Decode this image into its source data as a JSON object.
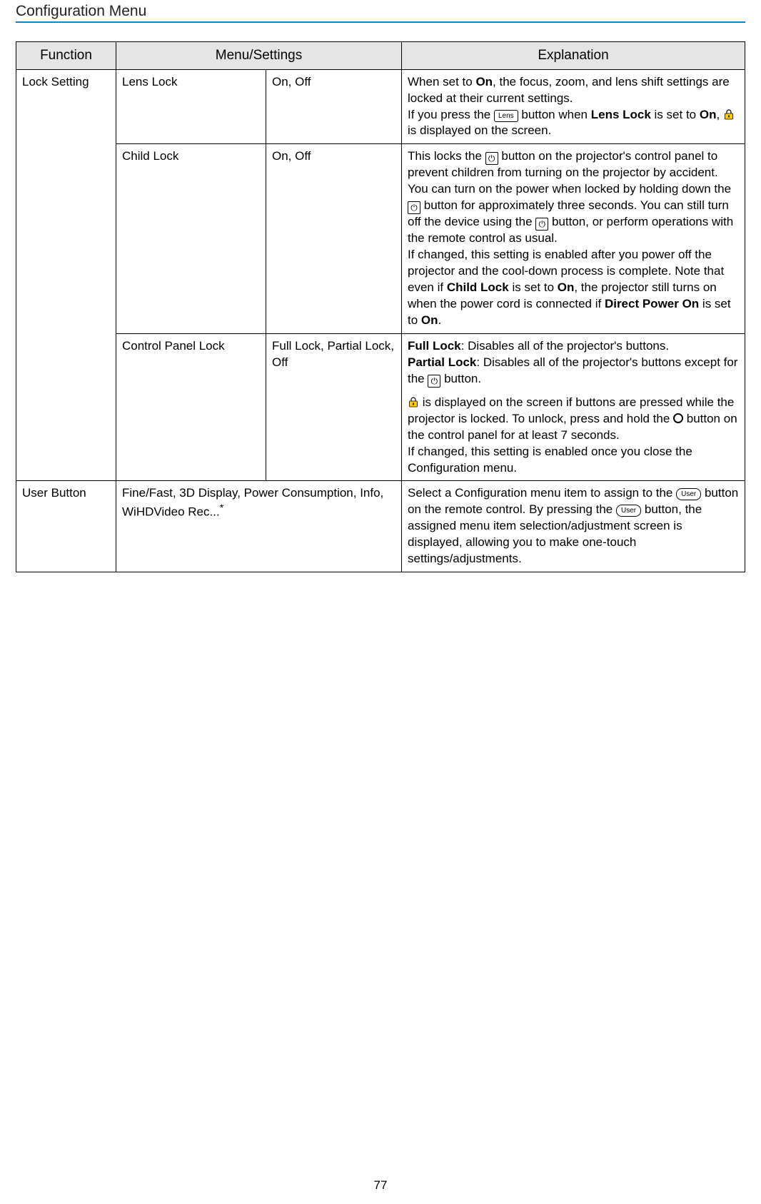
{
  "page": {
    "header": "Configuration Menu",
    "number": "77"
  },
  "table": {
    "headers": {
      "function": "Function",
      "menu": "Menu/Settings",
      "explanation": "Explanation"
    },
    "rows": {
      "lock_setting": {
        "function": "Lock Setting",
        "lens_lock": {
          "menu": "Lens Lock",
          "settings": "On, Off",
          "exp_pre": "When set to ",
          "exp_on1": "On",
          "exp_mid1": ", the focus, zoom, and lens shift settings are locked at their current settings.",
          "exp_line2a": "If you press the ",
          "lens_btn": "Lens",
          "exp_line2b": " button when ",
          "exp_lenslock_b": "Lens Lock",
          "exp_line2c": " is set to ",
          "exp_on2": "On",
          "exp_line2d": ", ",
          "exp_line2e": " is displayed on the screen."
        },
        "child_lock": {
          "menu": "Child Lock",
          "settings": "On, Off",
          "t1": "This locks the ",
          "t2": " button on the projector's control panel to prevent children from turning on the projector by accident. You can turn on the power when locked by holding down the ",
          "t3": " button for approximately three seconds. You can still turn off the device using the ",
          "t4": " button, or perform operations with the remote control as usual.",
          "t5": "If changed, this setting is enabled after you power off the projector and the cool-down process is complete. Note that even if ",
          "b_childlock": "Child Lock",
          "t6": " is set to ",
          "b_on": "On",
          "t7": ", the projector still turns on when the power cord is connected if ",
          "b_dpo": "Direct Power On",
          "t8": " is set to ",
          "b_on2": "On",
          "t9": "."
        },
        "cpl": {
          "menu": "Control Panel Lock",
          "settings": "Full Lock, Partial Lock, Off",
          "b_full": "Full Lock",
          "t1": ": Disables all of the projector's buttons.",
          "b_partial": "Partial Lock",
          "t2": ": Disables all of the projector's buttons except for the ",
          "t3": " button.",
          "t4": " is displayed on the screen if buttons are pressed while the projector is locked. To unlock, press and hold the ",
          "t5": " button on the control panel for at least 7 seconds.",
          "t6": "If changed, this setting is enabled once you close the Configuration menu."
        }
      },
      "user_button": {
        "function": "User Button",
        "menu": "Fine/Fast, 3D Display, Power Consumption, Info, WiHDVideo Rec...",
        "asterisk": "*",
        "t1": "Select a Configuration menu item to assign to the ",
        "user_btn": "User",
        "t2": " button on the remote control. By pressing the ",
        "t3": " button, the assigned menu item selection/adjustment screen is displayed, allowing you to make one-touch settings/adjustments."
      }
    }
  }
}
